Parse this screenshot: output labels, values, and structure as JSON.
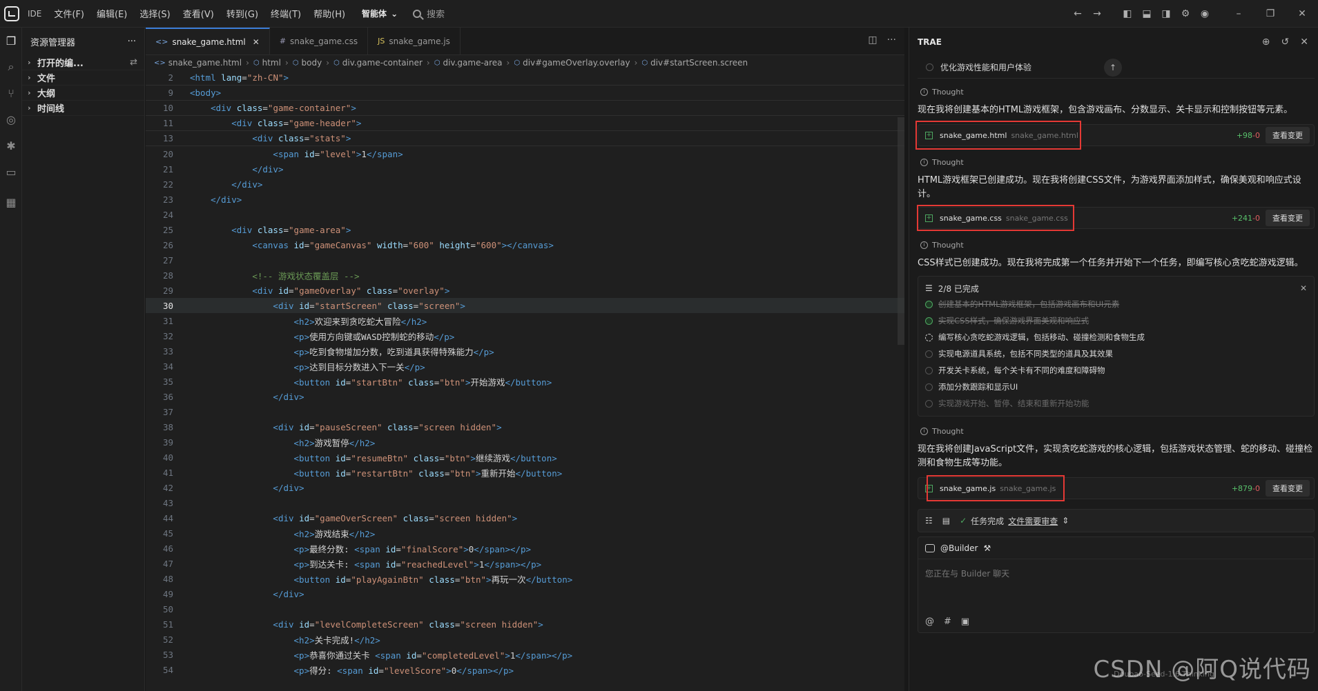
{
  "menubar": {
    "ide": "IDE",
    "items": [
      "文件(F)",
      "编辑(E)",
      "选择(S)",
      "查看(V)",
      "转到(G)",
      "终端(T)",
      "帮助(H)"
    ],
    "agent": "智能体",
    "search": "搜索"
  },
  "explorer": {
    "title": "资源管理器",
    "rows": [
      "打开的编...",
      "文件",
      "大纲",
      "时间线"
    ]
  },
  "editor": {
    "tabs": [
      {
        "icon": "<>",
        "label": "snake_game.html"
      },
      {
        "icon": "#",
        "label": "snake_game.css"
      },
      {
        "icon": "JS",
        "label": "snake_game.js"
      }
    ],
    "breadcrumb": [
      "snake_game.html",
      "html",
      "body",
      "div.game-container",
      "div.game-area",
      "div#gameOverlay.overlay",
      "div#startScreen.screen"
    ],
    "sticky_lines": [
      {
        "n": "2",
        "html": "<span class=\"tag\">&lt;html</span> <span class=\"attr\">lang</span>=<span class=\"str\">\"zh-CN\"</span><span class=\"tag\">&gt;</span>"
      },
      {
        "n": "9",
        "html": "<span class=\"tag\">&lt;body&gt;</span>"
      },
      {
        "n": "10",
        "html": "    <span class=\"tag\">&lt;div</span> <span class=\"attr\">class</span>=<span class=\"str\">\"game-container\"</span><span class=\"tag\">&gt;</span>"
      },
      {
        "n": "11",
        "html": "        <span class=\"tag\">&lt;div</span> <span class=\"attr\">class</span>=<span class=\"str\">\"game-header\"</span><span class=\"tag\">&gt;</span>"
      },
      {
        "n": "13",
        "html": "            <span class=\"tag\">&lt;div</span> <span class=\"attr\">class</span>=<span class=\"str\">\"stats\"</span><span class=\"tag\">&gt;</span>"
      }
    ],
    "code_lines": [
      {
        "n": "20",
        "html": "                <span class=\"tag\">&lt;span</span> <span class=\"attr\">id</span>=<span class=\"str\">\"level\"</span><span class=\"tag\">&gt;</span>1<span class=\"tag\">&lt;/span&gt;</span>"
      },
      {
        "n": "21",
        "html": "            <span class=\"tag\">&lt;/div&gt;</span>"
      },
      {
        "n": "22",
        "html": "        <span class=\"tag\">&lt;/div&gt;</span>"
      },
      {
        "n": "23",
        "html": "    <span class=\"tag\">&lt;/div&gt;</span>"
      },
      {
        "n": "24",
        "html": ""
      },
      {
        "n": "25",
        "html": "        <span class=\"tag\">&lt;div</span> <span class=\"attr\">class</span>=<span class=\"str\">\"game-area\"</span><span class=\"tag\">&gt;</span>"
      },
      {
        "n": "26",
        "html": "            <span class=\"tag\">&lt;canvas</span> <span class=\"attr\">id</span>=<span class=\"str\">\"gameCanvas\"</span> <span class=\"attr\">width</span>=<span class=\"str\">\"600\"</span> <span class=\"attr\">height</span>=<span class=\"str\">\"600\"</span><span class=\"tag\">&gt;&lt;/canvas&gt;</span>"
      },
      {
        "n": "27",
        "html": ""
      },
      {
        "n": "28",
        "html": "            <span class=\"cmt\">&lt;!-- 游戏状态覆盖层 --&gt;</span>"
      },
      {
        "n": "29",
        "html": "            <span class=\"tag\">&lt;div</span> <span class=\"attr\">id</span>=<span class=\"str\">\"gameOverlay\"</span> <span class=\"attr\">class</span>=<span class=\"str\">\"overlay\"</span><span class=\"tag\">&gt;</span>"
      },
      {
        "n": "30",
        "html": "                <span class=\"tag\">&lt;div</span> <span class=\"attr\">id</span>=<span class=\"str\">\"startScreen\"</span> <span class=\"attr\">class</span>=<span class=\"str\">\"screen\"</span><span class=\"tag\">&gt;</span>",
        "current": true
      },
      {
        "n": "31",
        "html": "                    <span class=\"tag\">&lt;h2&gt;</span>欢迎来到贪吃蛇大冒险<span class=\"tag\">&lt;/h2&gt;</span>"
      },
      {
        "n": "32",
        "html": "                    <span class=\"tag\">&lt;p&gt;</span>使用方向键或WASD控制蛇的移动<span class=\"tag\">&lt;/p&gt;</span>"
      },
      {
        "n": "33",
        "html": "                    <span class=\"tag\">&lt;p&gt;</span>吃到食物增加分数，吃到道具获得特殊能力<span class=\"tag\">&lt;/p&gt;</span>"
      },
      {
        "n": "34",
        "html": "                    <span class=\"tag\">&lt;p&gt;</span>达到目标分数进入下一关<span class=\"tag\">&lt;/p&gt;</span>"
      },
      {
        "n": "35",
        "html": "                    <span class=\"tag\">&lt;button</span> <span class=\"attr\">id</span>=<span class=\"str\">\"startBtn\"</span> <span class=\"attr\">class</span>=<span class=\"str\">\"btn\"</span><span class=\"tag\">&gt;</span>开始游戏<span class=\"tag\">&lt;/button&gt;</span>"
      },
      {
        "n": "36",
        "html": "                <span class=\"tag\">&lt;/div&gt;</span>"
      },
      {
        "n": "37",
        "html": ""
      },
      {
        "n": "38",
        "html": "                <span class=\"tag\">&lt;div</span> <span class=\"attr\">id</span>=<span class=\"str\">\"pauseScreen\"</span> <span class=\"attr\">class</span>=<span class=\"str\">\"screen hidden\"</span><span class=\"tag\">&gt;</span>"
      },
      {
        "n": "39",
        "html": "                    <span class=\"tag\">&lt;h2&gt;</span>游戏暂停<span class=\"tag\">&lt;/h2&gt;</span>"
      },
      {
        "n": "40",
        "html": "                    <span class=\"tag\">&lt;button</span> <span class=\"attr\">id</span>=<span class=\"str\">\"resumeBtn\"</span> <span class=\"attr\">class</span>=<span class=\"str\">\"btn\"</span><span class=\"tag\">&gt;</span>继续游戏<span class=\"tag\">&lt;/button&gt;</span>"
      },
      {
        "n": "41",
        "html": "                    <span class=\"tag\">&lt;button</span> <span class=\"attr\">id</span>=<span class=\"str\">\"restartBtn\"</span> <span class=\"attr\">class</span>=<span class=\"str\">\"btn\"</span><span class=\"tag\">&gt;</span>重新开始<span class=\"tag\">&lt;/button&gt;</span>"
      },
      {
        "n": "42",
        "html": "                <span class=\"tag\">&lt;/div&gt;</span>"
      },
      {
        "n": "43",
        "html": ""
      },
      {
        "n": "44",
        "html": "                <span class=\"tag\">&lt;div</span> <span class=\"attr\">id</span>=<span class=\"str\">\"gameOverScreen\"</span> <span class=\"attr\">class</span>=<span class=\"str\">\"screen hidden\"</span><span class=\"tag\">&gt;</span>"
      },
      {
        "n": "45",
        "html": "                    <span class=\"tag\">&lt;h2&gt;</span>游戏结束<span class=\"tag\">&lt;/h2&gt;</span>"
      },
      {
        "n": "46",
        "html": "                    <span class=\"tag\">&lt;p&gt;</span>最终分数: <span class=\"tag\">&lt;span</span> <span class=\"attr\">id</span>=<span class=\"str\">\"finalScore\"</span><span class=\"tag\">&gt;</span>0<span class=\"tag\">&lt;/span&gt;&lt;/p&gt;</span>"
      },
      {
        "n": "47",
        "html": "                    <span class=\"tag\">&lt;p&gt;</span>到达关卡: <span class=\"tag\">&lt;span</span> <span class=\"attr\">id</span>=<span class=\"str\">\"reachedLevel\"</span><span class=\"tag\">&gt;</span>1<span class=\"tag\">&lt;/span&gt;&lt;/p&gt;</span>"
      },
      {
        "n": "48",
        "html": "                    <span class=\"tag\">&lt;button</span> <span class=\"attr\">id</span>=<span class=\"str\">\"playAgainBtn\"</span> <span class=\"attr\">class</span>=<span class=\"str\">\"btn\"</span><span class=\"tag\">&gt;</span>再玩一次<span class=\"tag\">&lt;/button&gt;</span>"
      },
      {
        "n": "49",
        "html": "                <span class=\"tag\">&lt;/div&gt;</span>"
      },
      {
        "n": "50",
        "html": ""
      },
      {
        "n": "51",
        "html": "                <span class=\"tag\">&lt;div</span> <span class=\"attr\">id</span>=<span class=\"str\">\"levelCompleteScreen\"</span> <span class=\"attr\">class</span>=<span class=\"str\">\"screen hidden\"</span><span class=\"tag\">&gt;</span>"
      },
      {
        "n": "52",
        "html": "                    <span class=\"tag\">&lt;h2&gt;</span>关卡完成!<span class=\"tag\">&lt;/h2&gt;</span>"
      },
      {
        "n": "53",
        "html": "                    <span class=\"tag\">&lt;p&gt;</span>恭喜你通过关卡 <span class=\"tag\">&lt;span</span> <span class=\"attr\">id</span>=<span class=\"str\">\"completedLevel\"</span><span class=\"tag\">&gt;</span>1<span class=\"tag\">&lt;/span&gt;&lt;/p&gt;</span>"
      },
      {
        "n": "54",
        "html": "                    <span class=\"tag\">&lt;p&gt;</span>得分: <span class=\"tag\">&lt;span</span> <span class=\"attr\">id</span>=<span class=\"str\">\"levelScore\"</span><span class=\"tag\">&gt;</span>0<span class=\"tag\">&lt;/span&gt;&lt;/p&gt;</span>"
      }
    ]
  },
  "ai": {
    "title": "TRAE",
    "pending_task": "优化游戏性能和用户体验",
    "thought_label": "Thought",
    "msg1": "现在我将创建基本的HTML游戏框架，包含游戏画布、分数显示、关卡显示和控制按钮等元素。",
    "file1": {
      "name": "snake_game.html",
      "path": "snake_game.html",
      "add": "+98",
      "del": "-0"
    },
    "msg2": "HTML游戏框架已创建成功。现在我将创建CSS文件，为游戏界面添加样式，确保美观和响应式设计。",
    "file2": {
      "name": "snake_game.css",
      "path": "snake_game.css",
      "add": "+241",
      "del": "-0"
    },
    "msg3": "CSS样式已创建成功。现在我将完成第一个任务并开始下一个任务，即编写核心贪吃蛇游戏逻辑。",
    "tasks_head": "2/8 已完成",
    "tasks": [
      {
        "label": "创建基本的HTML游戏框架，包括游戏画布和UI元素",
        "state": "done"
      },
      {
        "label": "实现CSS样式，确保游戏界面美观和响应式",
        "state": "done"
      },
      {
        "label": "编写核心贪吃蛇游戏逻辑，包括移动、碰撞检测和食物生成",
        "state": "progress"
      },
      {
        "label": "实现电源道具系统，包括不同类型的道具及其效果",
        "state": "todo"
      },
      {
        "label": "开发关卡系统，每个关卡有不同的难度和障碍物",
        "state": "todo"
      },
      {
        "label": "添加分数跟踪和显示UI",
        "state": "todo"
      },
      {
        "label": "实现游戏开始、暂停、结束和重新开始功能",
        "state": "faded"
      }
    ],
    "msg4": "现在我将创建JavaScript文件，实现贪吃蛇游戏的核心逻辑，包括游戏状态管理、蛇的移动、碰撞检测和食物生成等功能。",
    "file3": {
      "name": "snake_game.js",
      "path": "snake_game.js",
      "add": "+879",
      "del": "-0"
    },
    "view_btn": "查看变更",
    "status_done": "任务完成",
    "status_review": "文件需要审查",
    "builder": "@Builder",
    "chat_placeholder": "您正在与 Builder 聊天",
    "watermark": "CSDN @阿Q说代码",
    "watermark_small": "Doubao-Seed-1.6-Thinking"
  },
  "colors": {
    "accent": "#3b7dd8",
    "added": "#58c16b",
    "removed": "#e06060",
    "highlight_box": "#e53935"
  }
}
